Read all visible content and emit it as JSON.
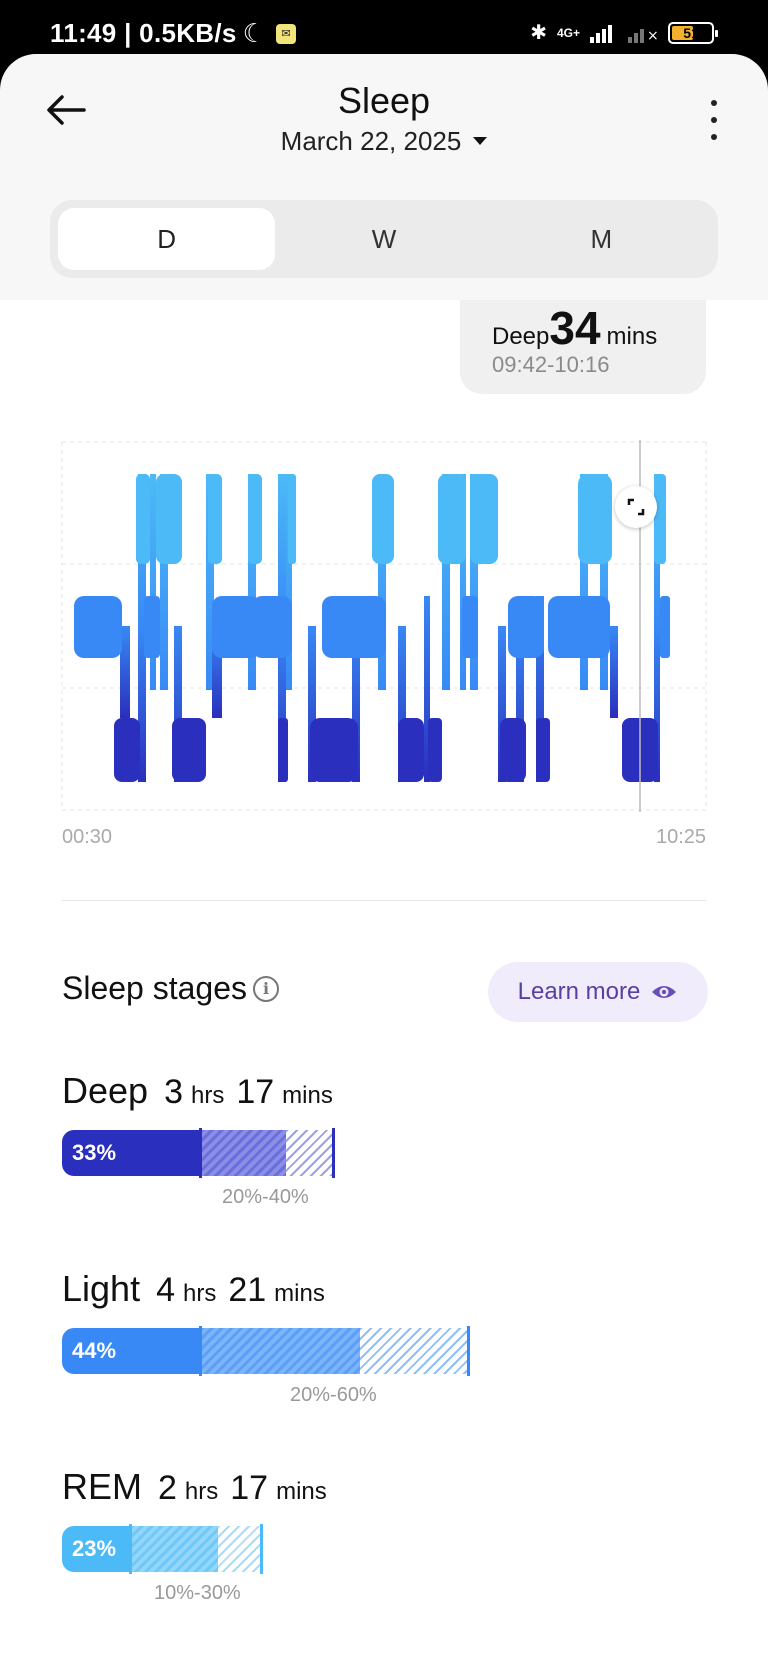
{
  "status_bar": {
    "time_speed": "11:49 | 0.5KB/s",
    "network": "4G+",
    "battery": "51"
  },
  "header": {
    "title": "Sleep",
    "date": "March 22, 2025"
  },
  "tabs": [
    {
      "label": "D",
      "active": true
    },
    {
      "label": "W",
      "active": false
    },
    {
      "label": "M",
      "active": false
    }
  ],
  "tooltip": {
    "stage": "Deep",
    "duration": "34",
    "unit": "mins",
    "range": "09:42-10:16"
  },
  "chart": {
    "x_start": "00:30",
    "x_end": "10:25",
    "colors": {
      "deep": "#2a2fbd",
      "light": "#3889f5",
      "rem": "#4cbaf7"
    }
  },
  "stages_section": {
    "title": "Sleep stages",
    "learn_more": "Learn more"
  },
  "stages": [
    {
      "name": "Deep",
      "hrs": "3",
      "hrs_unit": "hrs",
      "mins": "17",
      "mins_unit": "mins",
      "percent": "33%",
      "range": "20%-40%",
      "color": "#2a2fbd"
    },
    {
      "name": "Light",
      "hrs": "4",
      "hrs_unit": "hrs",
      "mins": "21",
      "mins_unit": "mins",
      "percent": "44%",
      "range": "20%-60%",
      "color": "#3889f5"
    },
    {
      "name": "REM",
      "hrs": "2",
      "hrs_unit": "hrs",
      "mins": "17",
      "mins_unit": "mins",
      "percent": "23%",
      "range": "10%-30%",
      "color": "#4cbaf7"
    }
  ]
}
